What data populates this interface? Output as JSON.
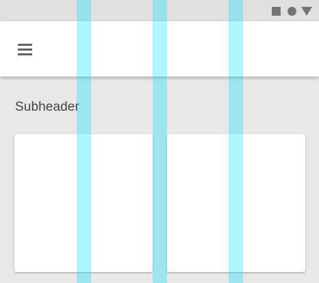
{
  "status_bar": {
    "icons": [
      "square-icon",
      "circle-icon",
      "triangle-icon"
    ],
    "icon_color": "#757575"
  },
  "app_bar": {
    "menu_icon": "menu-icon",
    "background": "#ffffff"
  },
  "content": {
    "subheader": "Subheader",
    "cards": [
      {
        "name": "card-1"
      },
      {
        "name": "card-2"
      }
    ]
  },
  "overlay": {
    "gutter_color": "#00e5ff",
    "gutter_opacity": 0.33,
    "gutter_count": 3
  },
  "colors": {
    "page_background": "#e8e8e8",
    "status_bar_background": "#e0e0e0",
    "text_primary": "#424242"
  }
}
